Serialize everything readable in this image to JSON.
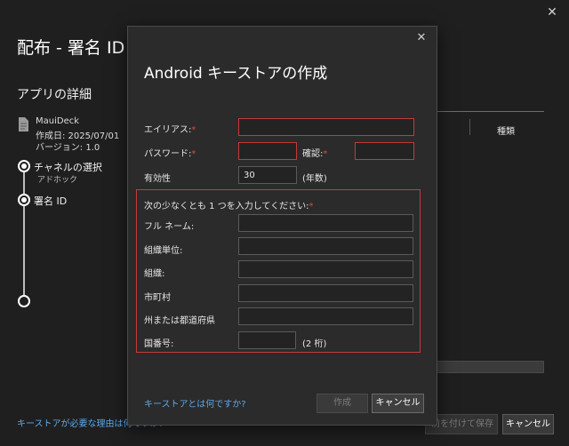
{
  "background": {
    "title": "配布 - 署名 ID",
    "app_details_heading": "アプリの詳細",
    "app": {
      "name": "MauiDeck",
      "created": "作成日: 2025/07/01",
      "version": "バージョン: 1.0"
    },
    "steps": {
      "channel": "チャネルの選択",
      "channel_sub": "アドホック",
      "signing": "署名 ID"
    },
    "table": {
      "type_header": "種類"
    },
    "help_link": "キーストアが必要な理由は何ですか?",
    "save_button": "前を付けて保存",
    "cancel_button": "キャンセル"
  },
  "dialog": {
    "title": "Android キーストアの作成",
    "required_mark": "*",
    "alias_label": "エイリアス:",
    "alias_value": "",
    "password_label": "パスワード:",
    "password_value": "",
    "confirm_label": "確認:",
    "confirm_value": "",
    "validity_label": "有効性",
    "validity_value": "30",
    "validity_unit": "(年数)",
    "identity_heading": "次の少なくとも 1 つを入力してください:",
    "fullname_label": "フル ネーム:",
    "orgunit_label": "組織単位:",
    "org_label": "組織:",
    "city_label": "市町村",
    "state_label": "州または都道府県",
    "country_label": "国番号:",
    "country_unit": "(2 桁)",
    "help_link": "キーストアとは何ですか?",
    "create_button": "作成",
    "cancel_button": "キャンセル"
  },
  "colors": {
    "background": "#1f1f1f",
    "dialog": "#2b2b2b",
    "error": "#c63a3a",
    "link": "#5fa8e8"
  },
  "icons": {
    "bg_close": "close-icon",
    "dialog_close": "close-icon",
    "app_file": "file-icon"
  }
}
